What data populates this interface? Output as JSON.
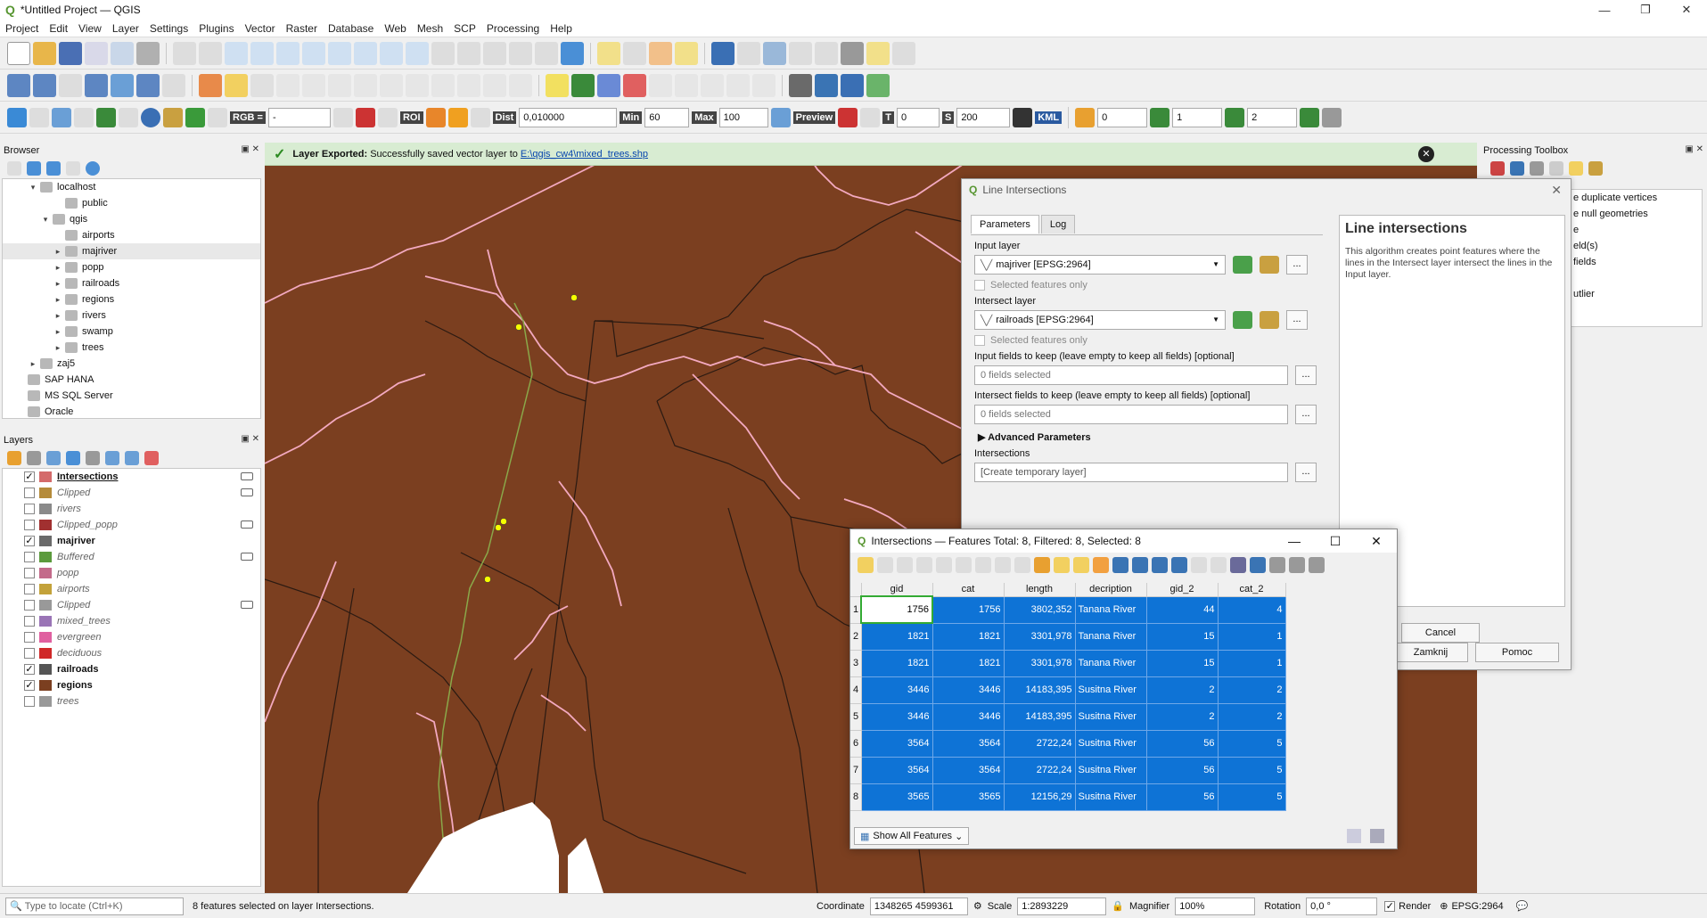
{
  "window": {
    "title": "*Untitled Project — QGIS",
    "controls": [
      "—",
      "❐",
      "✕"
    ]
  },
  "menu": [
    "Project",
    "Edit",
    "View",
    "Layer",
    "Settings",
    "Plugins",
    "Vector",
    "Raster",
    "Database",
    "Web",
    "Mesh",
    "SCP",
    "Processing",
    "Help"
  ],
  "scp_toolbar": {
    "rgb_label": "RGB =",
    "rgb_value": "-",
    "roi_label": "ROI",
    "dist_label": "Dist",
    "dist_value": "0,010000",
    "min_label": "Min",
    "min_value": "60",
    "max_label": "Max",
    "max_value": "100",
    "preview_label": "Preview",
    "t_label": "T",
    "t_value": "0",
    "s_label": "S",
    "s_value": "200",
    "kml": "KML",
    "v1": "0",
    "v2": "1",
    "v3": "2"
  },
  "browser": {
    "title": "Browser",
    "items": [
      {
        "label": "localhost",
        "indent": 1,
        "arrow": "▾"
      },
      {
        "label": "public",
        "indent": 3,
        "arrow": ""
      },
      {
        "label": "qgis",
        "indent": 2,
        "arrow": "▾"
      },
      {
        "label": "airports",
        "indent": 3,
        "arrow": ""
      },
      {
        "label": "majriver",
        "indent": 3,
        "arrow": "▸",
        "selected": true
      },
      {
        "label": "popp",
        "indent": 3,
        "arrow": "▸"
      },
      {
        "label": "railroads",
        "indent": 3,
        "arrow": "▸"
      },
      {
        "label": "regions",
        "indent": 3,
        "arrow": "▸"
      },
      {
        "label": "rivers",
        "indent": 3,
        "arrow": "▸"
      },
      {
        "label": "swamp",
        "indent": 3,
        "arrow": "▸"
      },
      {
        "label": "trees",
        "indent": 3,
        "arrow": "▸"
      },
      {
        "label": "zaj5",
        "indent": 1,
        "arrow": "▸"
      },
      {
        "label": "SAP HANA",
        "indent": 0,
        "arrow": ""
      },
      {
        "label": "MS SQL Server",
        "indent": 0,
        "arrow": ""
      },
      {
        "label": "Oracle",
        "indent": 0,
        "arrow": ""
      }
    ]
  },
  "layers": {
    "title": "Layers",
    "items": [
      {
        "label": "Intersections",
        "checked": true,
        "bold": true,
        "underline": true,
        "sym": "#d46a6a",
        "exp": true
      },
      {
        "label": "Clipped",
        "checked": false,
        "sym": "#b58b3a",
        "exp": true
      },
      {
        "label": "rivers",
        "checked": false,
        "sym": "#8a8a8a"
      },
      {
        "label": "Clipped_popp",
        "checked": false,
        "sym": "#a13030",
        "exp": true
      },
      {
        "label": "majriver",
        "checked": true,
        "bold": true,
        "sym": "#6a6a6a"
      },
      {
        "label": "Buffered",
        "checked": false,
        "sym": "#5b9a3c",
        "exp": true
      },
      {
        "label": "popp",
        "checked": false,
        "sym": "#c36a8a"
      },
      {
        "label": "airports",
        "checked": false,
        "sym": "#c3a23a"
      },
      {
        "label": "Clipped",
        "checked": false,
        "sym": "#999",
        "exp": true
      },
      {
        "label": "mixed_trees",
        "checked": false,
        "sym": "#9a74b6"
      },
      {
        "label": "evergreen",
        "checked": false,
        "sym": "#e060a0"
      },
      {
        "label": "deciduous",
        "checked": false,
        "sym": "#d02828"
      },
      {
        "label": "railroads",
        "checked": true,
        "bold": true,
        "sym": "#555"
      },
      {
        "label": "regions",
        "checked": true,
        "bold": true,
        "sym": "#7b3f20"
      },
      {
        "label": "trees",
        "checked": false,
        "sym": "#999"
      }
    ]
  },
  "message": {
    "title": "Layer Exported:",
    "text": "Successfully saved vector layer to",
    "link": "E:\\qgis_cw4\\mixed_trees.shp"
  },
  "toolbox": {
    "title": "Processing Toolbox",
    "items": [
      "e duplicate vertices",
      "e null geometries",
      "e",
      "eld(s)",
      "fields",
      "",
      "utlier"
    ]
  },
  "dialog": {
    "title": "Line Intersections",
    "tabs": [
      "Parameters",
      "Log"
    ],
    "input_layer_label": "Input layer",
    "input_layer_value": "majriver [EPSG:2964]",
    "selected_only": "Selected features only",
    "intersect_layer_label": "Intersect layer",
    "intersect_layer_value": "railroads [EPSG:2964]",
    "input_fields_label": "Input fields to keep (leave empty to keep all fields) [optional]",
    "input_fields_value": "0 fields selected",
    "intersect_fields_label": "Intersect fields to keep (leave empty to keep all fields) [optional]",
    "intersect_fields_value": "0 fields selected",
    "advanced": "Advanced Parameters",
    "output_label": "Intersections",
    "output_placeholder": "[Create temporary layer]",
    "help_title": "Line intersections",
    "help_text": "This algorithm creates point features where the lines in the Intersect layer intersect the lines in the Input layer.",
    "cancel": "Cancel",
    "close": "Zamknij",
    "help_btn": "Pomoc",
    "dots": "..."
  },
  "attr_table": {
    "title": "Intersections — Features Total: 8, Filtered: 8, Selected: 8",
    "columns": [
      "gid",
      "cat",
      "length",
      "decription",
      "gid_2",
      "cat_2"
    ],
    "rows": [
      [
        "1",
        "1756",
        "1756",
        "3802,352",
        "Tanana River",
        "44",
        "4"
      ],
      [
        "2",
        "1821",
        "1821",
        "3301,978",
        "Tanana River",
        "15",
        "1"
      ],
      [
        "3",
        "1821",
        "1821",
        "3301,978",
        "Tanana River",
        "15",
        "1"
      ],
      [
        "4",
        "3446",
        "3446",
        "14183,395",
        "Susitna River",
        "2",
        "2"
      ],
      [
        "5",
        "3446",
        "3446",
        "14183,395",
        "Susitna River",
        "2",
        "2"
      ],
      [
        "6",
        "3564",
        "3564",
        "2722,24",
        "Susitna River",
        "56",
        "5"
      ],
      [
        "7",
        "3564",
        "3564",
        "2722,24",
        "Susitna River",
        "56",
        "5"
      ],
      [
        "8",
        "3565",
        "3565",
        "12156,29",
        "Susitna River",
        "56",
        "5"
      ]
    ],
    "show_all": "Show All Features"
  },
  "status": {
    "locate_placeholder": "Type to locate (Ctrl+K)",
    "message": "8 features selected on layer Intersections.",
    "coordinate_label": "Coordinate",
    "coordinate": "1348265  4599361",
    "scale_label": "Scale",
    "scale": "1:2893229",
    "magnifier_label": "Magnifier",
    "magnifier": "100%",
    "rotation_label": "Rotation",
    "rotation": "0,0 °",
    "render": "Render",
    "crs": "EPSG:2964"
  }
}
